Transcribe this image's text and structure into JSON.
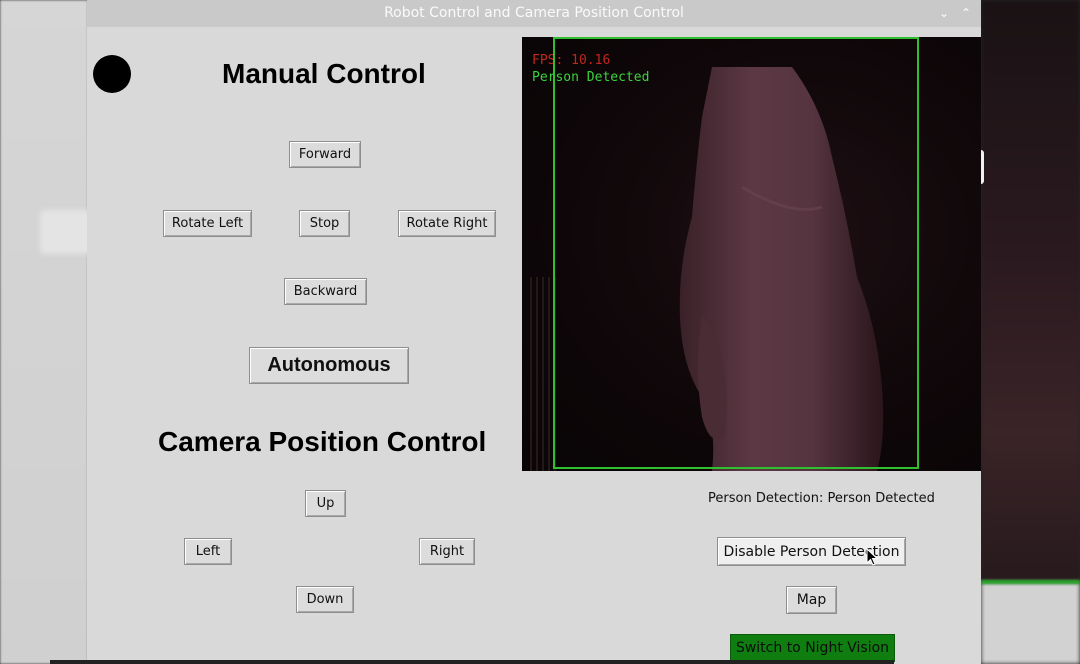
{
  "window": {
    "title": "Robot Control and Camera Position Control",
    "minimize_glyph": "⌄",
    "maximize_glyph": "⌃"
  },
  "manual_control": {
    "heading": "Manual Control",
    "forward": "Forward",
    "rotate_left": "Rotate Left",
    "stop": "Stop",
    "rotate_right": "Rotate Right",
    "backward": "Backward",
    "autonomous": "Autonomous"
  },
  "camera_position_control": {
    "heading": "Camera Position Control",
    "up": "Up",
    "left": "Left",
    "right": "Right",
    "down": "Down"
  },
  "camera_feed": {
    "fps_text": "FPS: 10.16",
    "overlay_label": "Person Detected"
  },
  "detection": {
    "status_text": "Person Detection: Person Detected",
    "toggle_button": "Disable Person Detection",
    "map_button": "Map",
    "night_vision_button": "Switch to Night Vision"
  },
  "colors": {
    "window_bg": "#d9d9d9",
    "night_button": "#0f7d0f",
    "bbox": "#2fbf2f",
    "fps_text": "#c0271d",
    "overlay_text": "#3bd33b"
  }
}
